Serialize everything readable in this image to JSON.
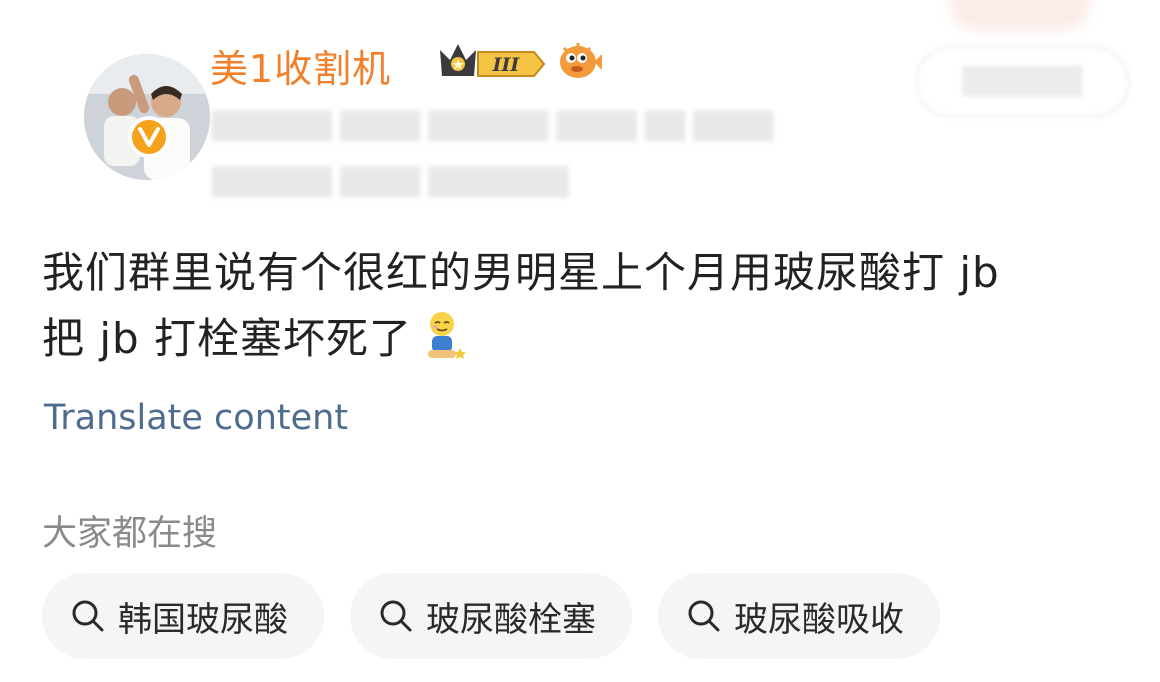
{
  "post": {
    "username": "美1收割机",
    "level_badge": "III",
    "text_line1": "我们群里说有个很红的男明星上个月用玻尿酸打 jb",
    "text_line2": "把 jb 打栓塞坏死了",
    "translate_label": "Translate content"
  },
  "trending": {
    "title": "大家都在搜",
    "chips": [
      {
        "label": "韩国玻尿酸",
        "icon": "search-icon"
      },
      {
        "label": "玻尿酸栓塞",
        "icon": "search-icon"
      },
      {
        "label": "玻尿酸吸收",
        "icon": "search-icon"
      }
    ]
  },
  "colors": {
    "username": "#f0802a",
    "translate_link": "#4f6b8e",
    "verified_badge": "#f7a21b",
    "chip_bg": "#f5f5f5"
  }
}
